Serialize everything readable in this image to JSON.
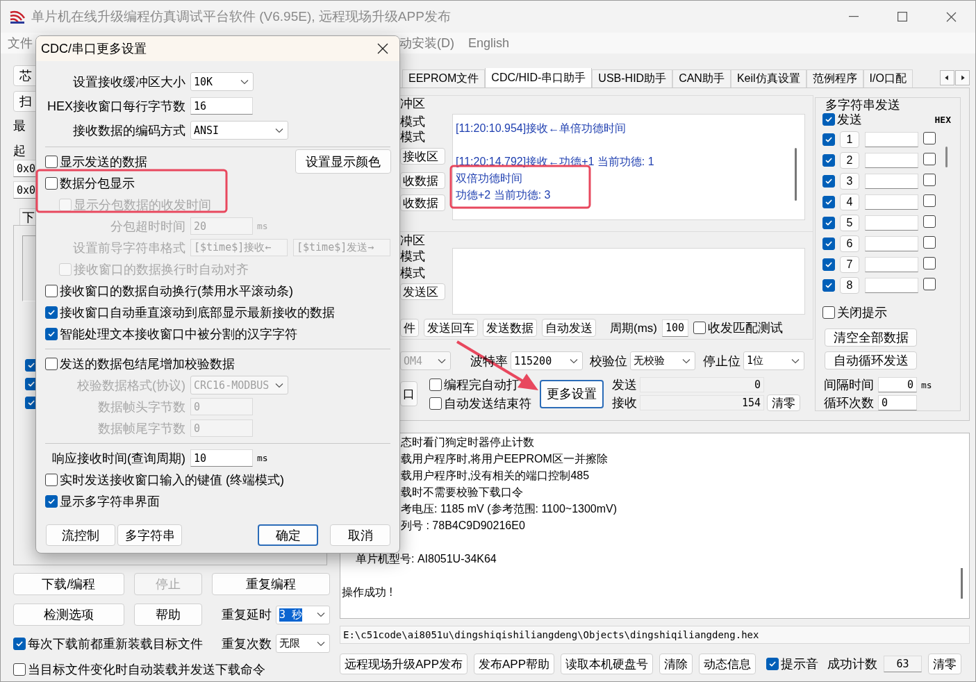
{
  "window": {
    "title": "单片机在线升级编程仿真调试平台软件 (V6.95E), 远程现场升级APP发布"
  },
  "menu": [
    {
      "label": "文件"
    },
    {
      "label": "动安装(D)"
    },
    {
      "label": "English"
    }
  ],
  "left_panel": {
    "buttons": [
      "芯",
      "扫"
    ],
    "labels": [
      "最",
      "起"
    ],
    "fields": [
      "0x0",
      "0x0"
    ],
    "tab": "下",
    "checkboxes": [
      {
        "checked": true
      },
      {
        "checked": true
      },
      {
        "checked": true
      }
    ]
  },
  "program": {
    "buttons": [
      {
        "label": "下载/编程",
        "disabled": false
      },
      {
        "label": "停止",
        "disabled": true
      },
      {
        "label": "重复编程",
        "disabled": false
      },
      {
        "label": "检测选项",
        "disabled": false
      },
      {
        "label": "帮助",
        "disabled": false
      }
    ],
    "repeat_delay": {
      "label": "重复延时",
      "value": "3 秒"
    },
    "repeat_count": {
      "label": "重复次数",
      "value": "无限"
    },
    "options": [
      {
        "label": "每次下载前都重新装载目标文件",
        "checked": true
      },
      {
        "label": "当目标文件变化时自动装载并发送下载命令",
        "checked": false
      }
    ]
  },
  "tabs": [
    {
      "label": "EEPROM文件",
      "selected": false
    },
    {
      "label": "CDC/HID-串口助手",
      "selected": true
    },
    {
      "label": "USB-HID助手",
      "selected": false
    },
    {
      "label": "CAN助手",
      "selected": false
    },
    {
      "label": "Keil仿真设置",
      "selected": false
    },
    {
      "label": "范例程序",
      "selected": false
    },
    {
      "label": "I/O口配",
      "selected": false
    }
  ],
  "serial": {
    "receive": {
      "labels": [
        "冲区",
        "模式",
        "模式"
      ],
      "buttons": [
        "接收区",
        "收数据",
        "收数据"
      ],
      "messages": [
        {
          "lines": [
            "[11:20:10.954]接收←单倍功德时间"
          ]
        },
        {
          "lines": [
            "[11:20:14.792]接收←功德+1 当前功德: 1",
            "双倍功德时间",
            "功德+2 当前功德: 3"
          ]
        }
      ]
    },
    "send": {
      "labels": [
        "冲区",
        "模式",
        "模式"
      ],
      "buttons": [
        "发送区"
      ]
    },
    "actions": [
      "件",
      "发送回车",
      "发送数据",
      "自动发送"
    ],
    "period": {
      "label": "周期(ms)",
      "value": "100"
    },
    "match_test": {
      "label": "收发匹配测试",
      "checked": false
    },
    "port": {
      "value": "OM4"
    },
    "baud": {
      "label": "波特率",
      "value": "115200"
    },
    "parity": {
      "label": "校验位",
      "value": "无校验"
    },
    "stop_bits": {
      "label": "停止位",
      "value": "1位"
    },
    "port_button": "口",
    "options": [
      {
        "label": "编程完自动打",
        "checked": false
      },
      {
        "label": "自动发送结束符",
        "checked": false
      }
    ],
    "more_settings": "更多设置",
    "counters": [
      {
        "label": "发送",
        "value": "0"
      },
      {
        "label": "接收",
        "value": "154"
      }
    ],
    "clear": "清零"
  },
  "multi_string": {
    "title": "多字符串发送",
    "send": {
      "label": "发送",
      "checked": true
    },
    "hex_label": "HEX",
    "rows": [
      {
        "number": "1",
        "checked": true,
        "hex": false
      },
      {
        "number": "2",
        "checked": true,
        "hex": false
      },
      {
        "number": "3",
        "checked": true,
        "hex": false
      },
      {
        "number": "4",
        "checked": true,
        "hex": false
      },
      {
        "number": "5",
        "checked": true,
        "hex": false
      },
      {
        "number": "6",
        "checked": true,
        "hex": false
      },
      {
        "number": "7",
        "checked": true,
        "hex": false
      },
      {
        "number": "8",
        "checked": true,
        "hex": false
      }
    ],
    "close_hint": {
      "label": "关闭提示",
      "checked": false
    },
    "buttons": [
      "清空全部数据",
      "自动循环发送"
    ],
    "interval": {
      "label": "间隔时间",
      "value": "0",
      "unit": "ms"
    },
    "loops": {
      "label": "循环次数",
      "value": "0"
    }
  },
  "log": {
    "groups": [
      {
        "lines": [
          "态时看门狗定时器停止计数",
          "载用户程序时,将用户EEPROM区一并擦除",
          "载用户程序时,没有相关的端口控制485",
          "载时不需要校验下载口令",
          "考电压: 1185 mV (参考范围: 1100~1300mV)",
          "列号 : 78B4C9D90216E0"
        ]
      },
      {
        "lines": [
          "单片机型号: AI8051U-34K64"
        ]
      },
      {
        "lines": [
          "操作成功 !"
        ]
      }
    ]
  },
  "file_path": "E:\\c51code\\ai8051u\\dingshiqishiliangdeng\\Objects\\dingshiqiliangdeng.hex",
  "footer": {
    "buttons": [
      "远程现场升级APP发布",
      "发布APP帮助",
      "读取本机硬盘号",
      "清除",
      "动态信息"
    ],
    "beep": {
      "label": "提示音",
      "checked": true
    },
    "success_count": {
      "label": "成功计数",
      "value": "63"
    },
    "clear": "清零"
  },
  "dialog": {
    "title": "CDC/串口更多设置",
    "items": [
      {
        "kind": "combo",
        "label": "设置接收缓冲区大小",
        "value": "10K",
        "disabled": false
      },
      {
        "kind": "field",
        "label": "HEX接收窗口每行字节数",
        "value": "16",
        "disabled": false
      },
      {
        "kind": "combo-wide",
        "label": "接收数据的编码方式",
        "value": "ANSI",
        "disabled": false
      },
      {
        "kind": "separator"
      },
      {
        "kind": "checkbox",
        "label": "显示发送的数据",
        "checked": false,
        "disabled": false,
        "button": "设置显示颜色"
      },
      {
        "kind": "checkbox",
        "label": "数据分包显示",
        "checked": false,
        "disabled": false
      },
      {
        "kind": "checkbox",
        "label": "显示分包数据的收发时间",
        "checked": false,
        "disabled": true
      },
      {
        "kind": "field",
        "label": "分包超时时间",
        "value": "20",
        "unit": "ms",
        "disabled": true
      },
      {
        "kind": "field-pair",
        "label": "设置前导字符串格式",
        "values": [
          "[$time$]接收←",
          "[$time$]发送→"
        ],
        "disabled": true
      },
      {
        "kind": "checkbox",
        "label": "接收窗口的数据换行时自动对齐",
        "checked": false,
        "disabled": true
      },
      {
        "kind": "checkbox",
        "label": "接收窗口的数据自动换行(禁用水平滚动条)",
        "checked": false,
        "disabled": false
      },
      {
        "kind": "checkbox",
        "label": "接收窗口自动垂直滚动到底部显示最新接收的数据",
        "checked": true,
        "disabled": false
      },
      {
        "kind": "checkbox",
        "label": "智能处理文本接收窗口中被分割的汉字字符",
        "checked": true,
        "disabled": false
      },
      {
        "kind": "separator"
      },
      {
        "kind": "checkbox",
        "label": "发送的数据包结尾增加校验数据",
        "checked": false,
        "disabled": false
      },
      {
        "kind": "combo-wide",
        "label": "校验数据格式(协议)",
        "value": "CRC16-MODBUS",
        "disabled": true
      },
      {
        "kind": "field",
        "label": "数据帧头字节数",
        "value": "0",
        "disabled": true
      },
      {
        "kind": "field",
        "label": "数据帧尾字节数",
        "value": "0",
        "disabled": true
      },
      {
        "kind": "separator"
      },
      {
        "kind": "field",
        "label": "响应接收时间(查询周期)",
        "value": "10",
        "unit": "ms",
        "disabled": false
      },
      {
        "kind": "checkbox",
        "label": "实时发送接收窗口输入的键值 (终端模式)",
        "checked": false,
        "disabled": false
      },
      {
        "kind": "checkbox",
        "label": "显示多字符串界面",
        "checked": true,
        "disabled": false
      }
    ],
    "buttons": [
      {
        "label": "流控制",
        "default": false
      },
      {
        "label": "多字符串",
        "default": false
      },
      {
        "label": "确定",
        "default": true
      },
      {
        "label": "取消",
        "default": false
      }
    ]
  }
}
